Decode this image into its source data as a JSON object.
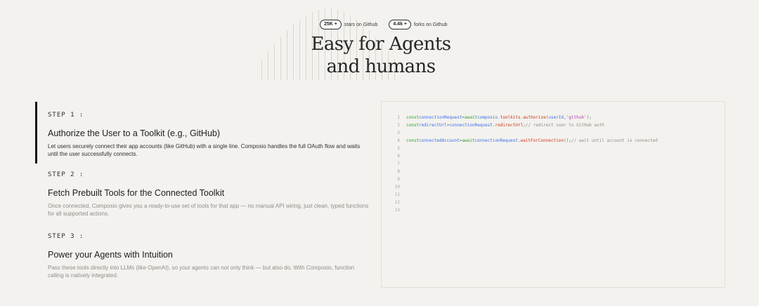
{
  "hero": {
    "stats": [
      {
        "value": "25K +",
        "label": "stars on Github"
      },
      {
        "value": "4.4k +",
        "label": "forks on Github"
      }
    ],
    "title_line1": "Easy for Agents",
    "title_line2": "and humans"
  },
  "steps": [
    {
      "label": "STEP 1 :",
      "title": "Authorize the User to a Toolkit (e.g., GitHub)",
      "description": "Let users securely connect their app accounts (like GitHub) with a single line. Composio handles the full OAuth flow and waits until the user successfully connects.",
      "active": true
    },
    {
      "label": "STEP 2 :",
      "title": "Fetch Prebuilt Tools for the Connected Toolkit",
      "description": "Once connected, Composio gives you a ready-to-use set of tools for that app — no manual API wiring, just clean, typed functions for all supported actions.",
      "active": false
    },
    {
      "label": "STEP 3 :",
      "title": "Power your Agents with Intuition",
      "description": "Pass these tools directly into LLMs (like OpenAI), so your agents can not only think — but also do. With Composio, function calling is natively integrated.",
      "active": false
    }
  ],
  "code": {
    "line_numbers": [
      "1",
      "2",
      "3",
      "4",
      "5",
      "6",
      "7",
      "8",
      "9",
      "10",
      "11",
      "12",
      "13"
    ],
    "line1": {
      "kw1": "const",
      "var": "connectionRequest",
      "op": "=",
      "kw2": "await",
      "obj": "composio",
      "p1": ".",
      "prop": "toolkits",
      "p2": ".",
      "fn": "authorize",
      "open": "(",
      "arg1": "userId",
      "comma": ",",
      "arg2": "'github'",
      "close": ");"
    },
    "line2": {
      "kw1": "const",
      "var": "redirectUrl",
      "op": "=",
      "obj": "connectionRequest",
      "p1": ".",
      "fn": "redirectUrl",
      "semi": ";",
      "comment": "// redirect user to GitHub auth"
    },
    "line4": {
      "kw1": "const",
      "var": "connectedAccount",
      "op": "=",
      "kw2": "await",
      "obj": "connectionRequest",
      "p1": ".",
      "fn": "waitForConnection",
      "call": "();",
      "comment": "// wait until account is connected"
    }
  }
}
